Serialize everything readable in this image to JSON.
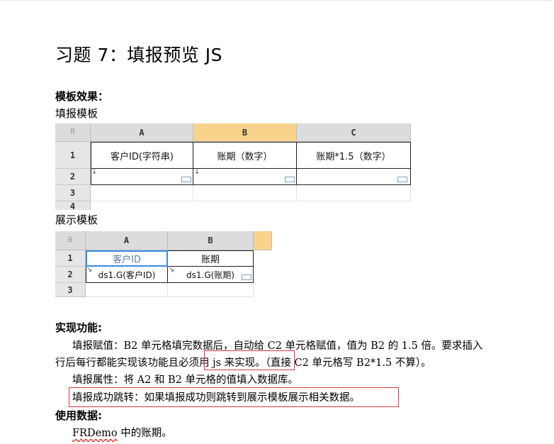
{
  "title": "习题 7：填报预览 JS",
  "section_template_effect": "模板效果：",
  "fill_template_label": "填报模板",
  "fill_sheet": {
    "columns": [
      "A",
      "B",
      "C"
    ],
    "rows": [
      "1",
      "2",
      "3",
      "4"
    ],
    "row1": [
      "客户ID(字符串)",
      "账期（数字）",
      "账期*1.5（数字）"
    ]
  },
  "display_template_label": "展示模板",
  "display_sheet": {
    "columns": [
      "A",
      "B"
    ],
    "rows": [
      "1",
      "2",
      "3"
    ],
    "row1": [
      "客户ID",
      "账期"
    ],
    "row2": [
      "ds1.G(客户ID)",
      "ds1.G(账期)"
    ]
  },
  "section_functions": "实现功能:",
  "para1_line1": "填报赋值：B2 单元格填完数据后，自动给 C2 单元格赋值，值为 B2 的 1.5 倍。要求插入",
  "para1_line2_a": "行后每行都能实现该功能且",
  "para1_line2_b": "必须用 js 来实现。",
  "para1_line2_c": "（直接 C2 单元格写 B2*1.5 不算）。",
  "para2": "填报属性：将 A2 和 B2 单元格的值填入数据库。",
  "para3": "填报成功跳转：如果填报成功则跳转到展示模板展示相关数据。",
  "section_data": "使用数据:",
  "data_source_a": "FRDemo",
  "data_source_b": " 中的账期。"
}
